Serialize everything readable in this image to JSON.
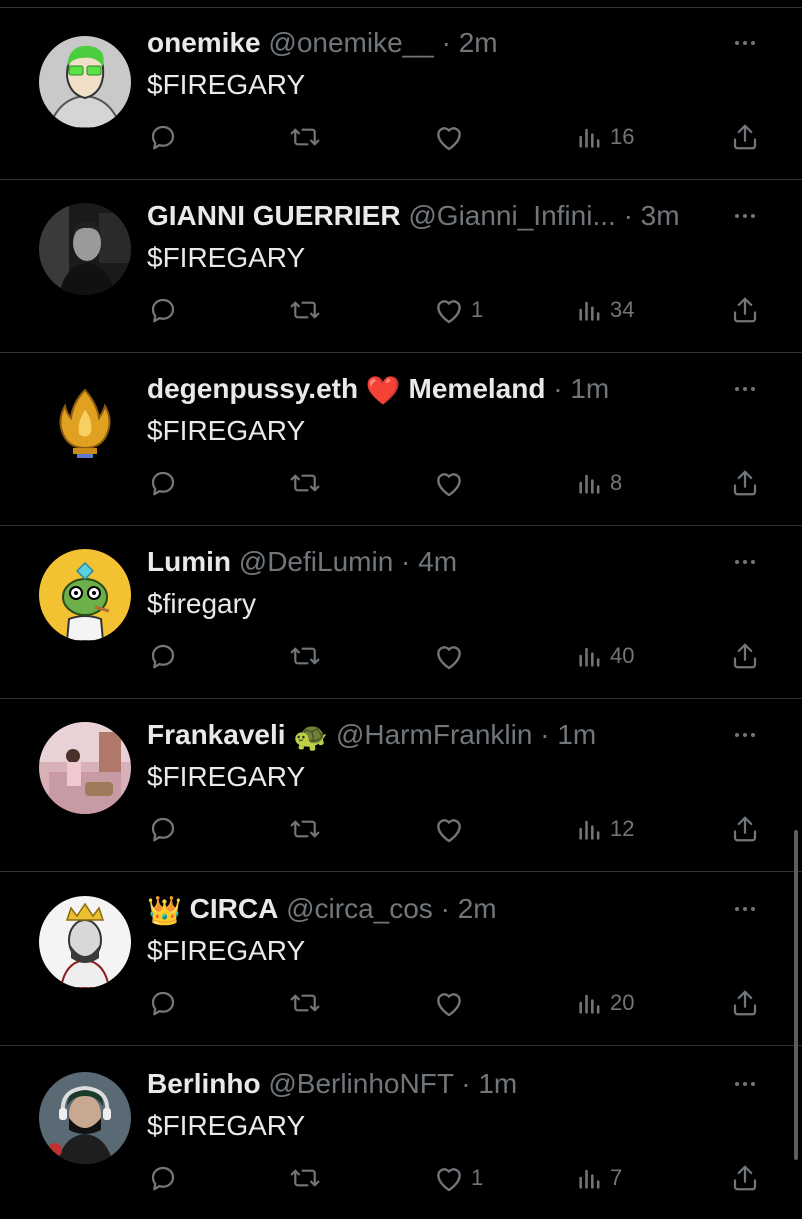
{
  "feed": {
    "tweets": [
      {
        "display_name": "onemike",
        "name_emoji": "",
        "handle": "@onemike__",
        "dot": "·",
        "time": "2m",
        "text": "$FIREGARY",
        "replies": "",
        "retweets": "",
        "likes": "",
        "views": "16",
        "avatar": "green-glasses-character"
      },
      {
        "display_name": "GIANNI GUERRIER",
        "name_emoji": "",
        "handle": "@Gianni_Infini...",
        "dot": "·",
        "time": "3m",
        "text": "$FIREGARY",
        "replies": "",
        "retweets": "",
        "likes": "1",
        "views": "34",
        "avatar": "bw-photo-man"
      },
      {
        "display_name": "degenpussy.eth",
        "name_emoji": "❤️",
        "handle": "Memeland",
        "dot": "·",
        "time": "1m",
        "text": "$FIREGARY",
        "replies": "",
        "retweets": "",
        "likes": "",
        "views": "8",
        "avatar": "gold-flame-trophy"
      },
      {
        "display_name": "Lumin",
        "name_emoji": "",
        "handle": "@DefiLumin",
        "dot": "·",
        "time": "4m",
        "text": "$firegary",
        "replies": "",
        "retweets": "",
        "likes": "",
        "views": "40",
        "avatar": "pepe-frog-on-yellow"
      },
      {
        "display_name": "Frankaveli",
        "name_emoji": "🐢",
        "handle": "@HarmFranklin",
        "dot": "·",
        "time": "1m",
        "text": "$FIREGARY",
        "replies": "",
        "retweets": "",
        "likes": "",
        "views": "12",
        "avatar": "pink-room-photo"
      },
      {
        "display_name": "CIRCA",
        "prefix_emoji": "👑",
        "name_emoji": "",
        "handle": "@circa_cos",
        "dot": "·",
        "time": "2m",
        "text": "$FIREGARY",
        "replies": "",
        "retweets": "",
        "likes": "",
        "views": "20",
        "avatar": "king-bearded-character"
      },
      {
        "display_name": "Berlinho",
        "name_emoji": "",
        "handle": "@BerlinhoNFT",
        "dot": "·",
        "time": "1m",
        "text": "$FIREGARY",
        "replies": "",
        "retweets": "",
        "likes": "1",
        "views": "7",
        "avatar": "masked-headphones-character"
      }
    ]
  },
  "colors": {
    "background": "#000000",
    "primary_text": "#e7e9ea",
    "secondary_text": "#71767b",
    "divider": "#2f3336"
  },
  "icons": {
    "reply": "reply-icon",
    "retweet": "retweet-icon",
    "like": "like-icon",
    "views": "views-icon",
    "share": "share-icon",
    "more": "more-icon"
  }
}
